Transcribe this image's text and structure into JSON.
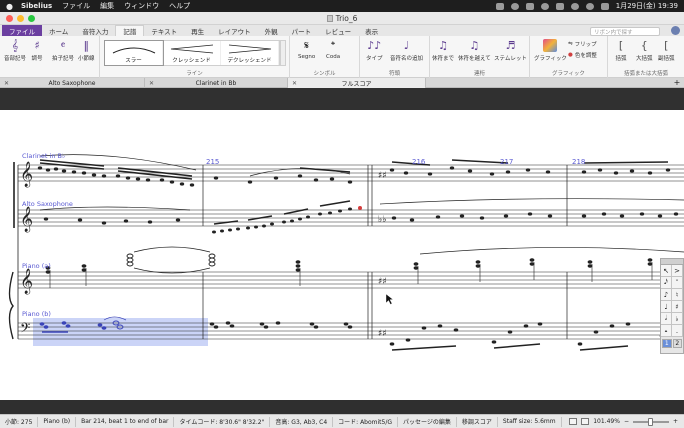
{
  "menubar": {
    "app_name": "Sibelius",
    "items": [
      "ファイル",
      "編集",
      "ウィンドウ",
      "ヘルプ"
    ],
    "clock": "1月29日(金)  19:39"
  },
  "window": {
    "title": "Trio_6"
  },
  "ribbon_tabs": [
    "ファイル",
    "ホーム",
    "音符入力",
    "記譜",
    "テキスト",
    "再生",
    "レイアウト",
    "外観",
    "パート",
    "レビュー",
    "表示"
  ],
  "ribbon_active_tab": "記譜",
  "ribbon_search_placeholder": "リボン内で探す",
  "ribbon": {
    "group_common": {
      "buttons": [
        "音部記号",
        "調号",
        "拍子記号",
        "小節線"
      ]
    },
    "group_line": {
      "label": "ライン",
      "gallery": [
        "スラー",
        "クレッシェンド",
        "デクレッシェンド"
      ]
    },
    "group_symbol": {
      "label": "シンボル",
      "buttons": [
        "Segno",
        "Coda"
      ]
    },
    "group_notehead": {
      "label": "符頭",
      "buttons": [
        "タイプ",
        "音符名の追加"
      ]
    },
    "group_beam": {
      "label": "連桁",
      "buttons": [
        "休符まで",
        "休符を越えて",
        "ステムレット"
      ]
    },
    "group_graphic": {
      "label": "グラフィック",
      "buttons": [
        "グラフィック"
      ],
      "small": [
        "フリップ",
        "色を調整"
      ]
    },
    "group_bracket": {
      "label": "括弧または大括弧",
      "buttons": [
        "括弧",
        "大括弧",
        "副括弧"
      ]
    }
  },
  "document_tabs": [
    "Alto Saxophone",
    "Clarinet in Bb",
    "フルスコア"
  ],
  "document_tab_active": "フルスコア",
  "score": {
    "instruments": [
      "Clarinet in B♭",
      "Alto Saxophone",
      "Piano (a)",
      "Piano (b)"
    ],
    "bar_numbers": [
      "215",
      "216",
      "217",
      "218"
    ]
  },
  "keypad": {
    "tabs": [
      "1",
      "2"
    ]
  },
  "statusbar": {
    "bar": "小節: 275",
    "instrument": "Piano (b)",
    "selection": "Bar 214, beat 1 to end of bar",
    "timecode": "タイムコード: 8'30.6\" 8'32.2\"",
    "pitch": "音高: G3, Ab3, C4",
    "chord": "コード: Abomit5/G",
    "passage": "パッセージの編集",
    "view": "移調スコア",
    "staff_size": "Staff size: 5.6mm",
    "zoom": "101.49%"
  },
  "colors": {
    "file_tab": "#6b3fa0",
    "selection": "#5a6ee6",
    "instrument_label": "#5a5ad2"
  }
}
